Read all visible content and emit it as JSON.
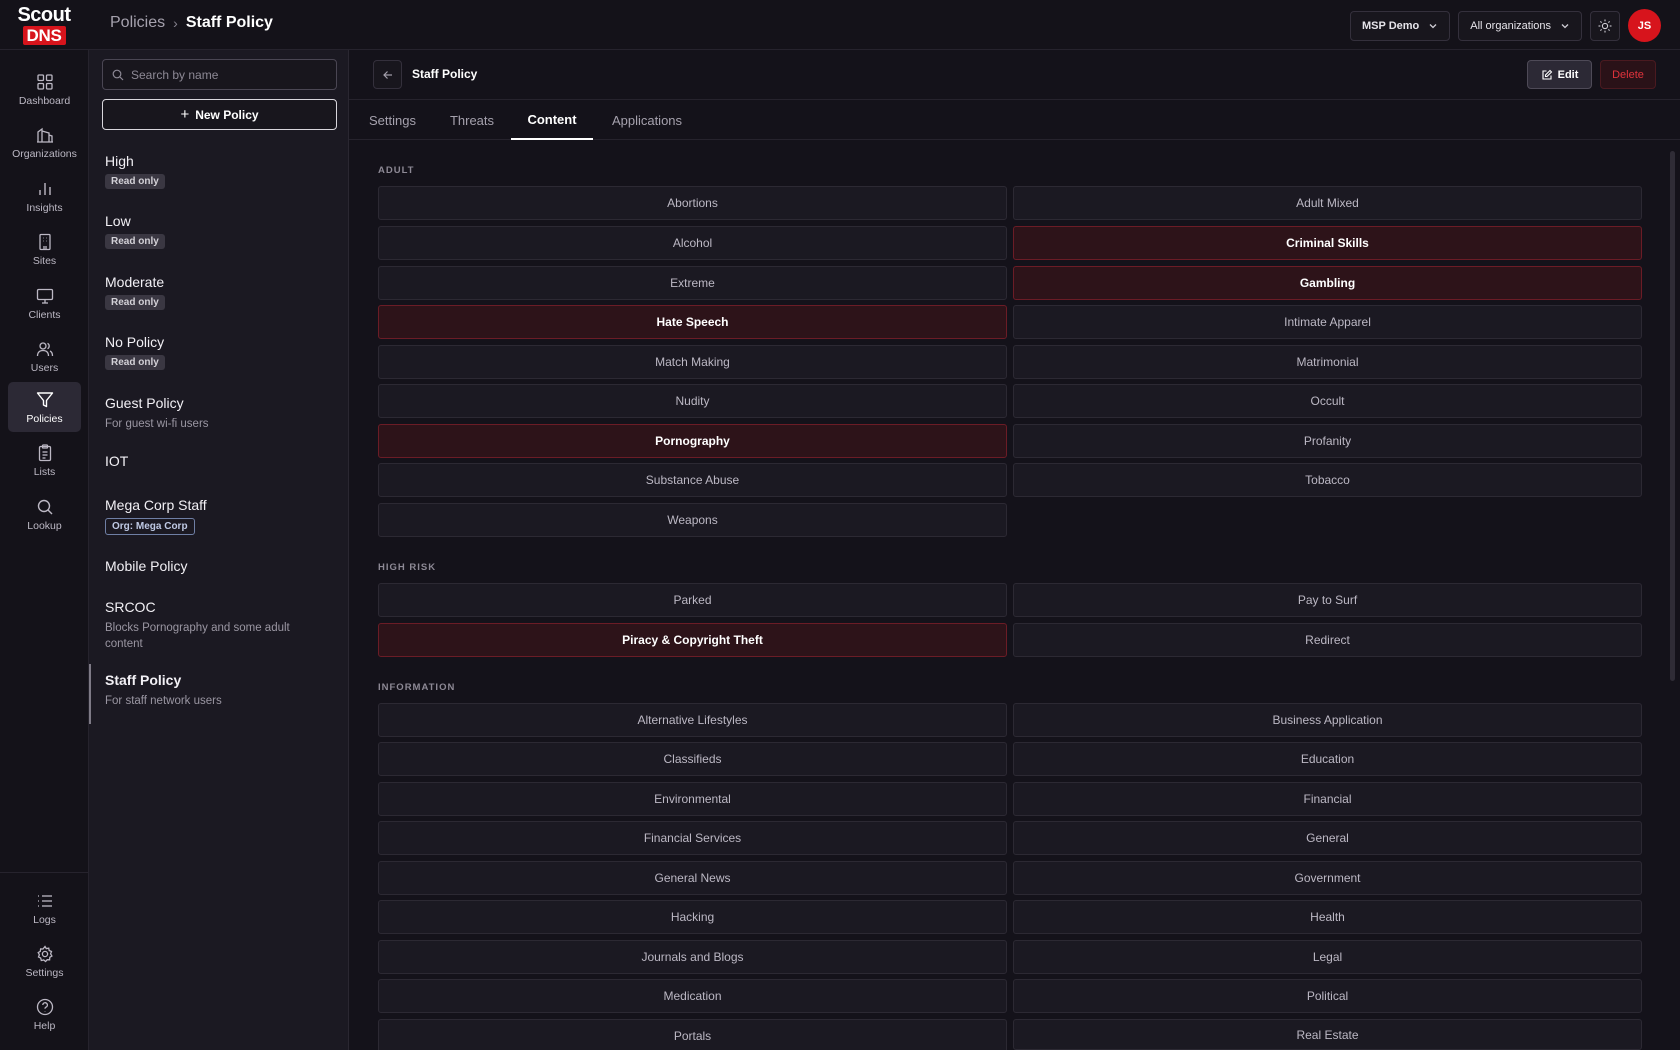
{
  "app": {
    "logo_line1": "Scout",
    "logo_line2": "DNS",
    "brand_color": "#d7141c"
  },
  "header": {
    "breadcrumb_parent": "Policies",
    "breadcrumb_current": "Staff Policy",
    "msp_label": "MSP Demo",
    "org_label": "All organizations",
    "avatar_initials": "JS"
  },
  "nav": {
    "dashboard": "Dashboard",
    "organizations": "Organizations",
    "insights": "Insights",
    "sites": "Sites",
    "clients": "Clients",
    "users": "Users",
    "policies": "Policies",
    "lists": "Lists",
    "lookup": "Lookup",
    "logs": "Logs",
    "settings": "Settings",
    "help": "Help"
  },
  "policy_list": {
    "search_placeholder": "Search by name",
    "new_policy_label": "New Policy",
    "items": [
      {
        "name": "High",
        "badge": "Read only"
      },
      {
        "name": "Low",
        "badge": "Read only"
      },
      {
        "name": "Moderate",
        "badge": "Read only"
      },
      {
        "name": "No Policy",
        "badge": "Read only"
      },
      {
        "name": "Guest Policy",
        "desc": "For guest wi-fi users"
      },
      {
        "name": "IOT"
      },
      {
        "name": "Mega Corp Staff",
        "org_badge": "Org: Mega Corp"
      },
      {
        "name": "Mobile Policy"
      },
      {
        "name": "SRCOC",
        "desc": "Blocks Pornography and some adult content"
      },
      {
        "name": "Staff Policy",
        "desc": "For staff network users",
        "selected": true
      }
    ]
  },
  "detail": {
    "title": "Staff Policy",
    "edit_label": "Edit",
    "delete_label": "Delete",
    "tabs": [
      "Settings",
      "Threats",
      "Content",
      "Applications"
    ],
    "active_tab": "Content",
    "sections": [
      {
        "title": "ADULT",
        "categories": [
          {
            "name": "Abortions",
            "blocked": false
          },
          {
            "name": "Adult Mixed",
            "blocked": false
          },
          {
            "name": "Alcohol",
            "blocked": false
          },
          {
            "name": "Criminal Skills",
            "blocked": true
          },
          {
            "name": "Extreme",
            "blocked": false
          },
          {
            "name": "Gambling",
            "blocked": true
          },
          {
            "name": "Hate Speech",
            "blocked": true
          },
          {
            "name": "Intimate Apparel",
            "blocked": false
          },
          {
            "name": "Match Making",
            "blocked": false
          },
          {
            "name": "Matrimonial",
            "blocked": false
          },
          {
            "name": "Nudity",
            "blocked": false
          },
          {
            "name": "Occult",
            "blocked": false
          },
          {
            "name": "Pornography",
            "blocked": true
          },
          {
            "name": "Profanity",
            "blocked": false
          },
          {
            "name": "Substance Abuse",
            "blocked": false
          },
          {
            "name": "Tobacco",
            "blocked": false
          },
          {
            "name": "Weapons",
            "blocked": false
          }
        ]
      },
      {
        "title": "HIGH RISK",
        "categories": [
          {
            "name": "Parked",
            "blocked": false
          },
          {
            "name": "Pay to Surf",
            "blocked": false
          },
          {
            "name": "Piracy & Copyright Theft",
            "blocked": true
          },
          {
            "name": "Redirect",
            "blocked": false
          }
        ]
      },
      {
        "title": "INFORMATION",
        "categories": [
          {
            "name": "Alternative Lifestyles",
            "blocked": false
          },
          {
            "name": "Business Application",
            "blocked": false
          },
          {
            "name": "Classifieds",
            "blocked": false
          },
          {
            "name": "Education",
            "blocked": false
          },
          {
            "name": "Environmental",
            "blocked": false
          },
          {
            "name": "Financial",
            "blocked": false
          },
          {
            "name": "Financial Services",
            "blocked": false
          },
          {
            "name": "General",
            "blocked": false
          },
          {
            "name": "General News",
            "blocked": false
          },
          {
            "name": "Government",
            "blocked": false
          },
          {
            "name": "Hacking",
            "blocked": false
          },
          {
            "name": "Health",
            "blocked": false
          },
          {
            "name": "Journals and Blogs",
            "blocked": false
          },
          {
            "name": "Legal",
            "blocked": false
          },
          {
            "name": "Medication",
            "blocked": false
          },
          {
            "name": "Political",
            "blocked": false
          },
          {
            "name": "Portals",
            "blocked": false
          },
          {
            "name": "Real Estate",
            "blocked": false
          }
        ]
      }
    ]
  }
}
